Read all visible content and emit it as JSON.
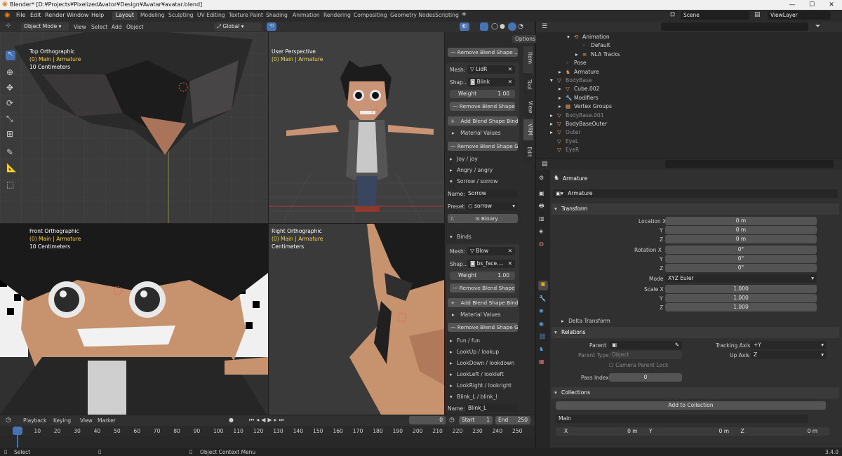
{
  "window": {
    "title": "Blender* [D:¥Projects¥PixelizedAvator¥Design¥Avatar¥avatar.blend]",
    "controls": [
      "—",
      "☐",
      "✕"
    ]
  },
  "menubar": {
    "items": [
      "File",
      "Edit",
      "Render",
      "Window",
      "Help"
    ]
  },
  "workspaces": [
    "Layout",
    "Modeling",
    "Sculpting",
    "UV Editing",
    "Texture Paint",
    "Shading",
    "Animation",
    "Rendering",
    "Compositing",
    "Geometry Nodes",
    "Scripting"
  ],
  "scene": {
    "name": "Scene",
    "view_layer": "ViewLayer"
  },
  "viewport_header": {
    "mode": "Object Mode",
    "menus": [
      "View",
      "Select",
      "Add",
      "Object"
    ],
    "transform": "Global",
    "options": "Options"
  },
  "viewports": {
    "top": {
      "title": "Top Orthographic",
      "sub": "(0) Main | Armature",
      "scale": "10 Centimeters"
    },
    "persp": {
      "title": "User Perspective",
      "sub": "(0) Main | Armature"
    },
    "front": {
      "title": "Front Orthographic",
      "sub": "(0) Main | Armature",
      "scale": "10 Centimeters"
    },
    "right": {
      "title": "Right Orthographic",
      "sub": "(0) Main | Armature",
      "scale": "Centimeters"
    }
  },
  "sidebar": {
    "tabs": [
      "Item",
      "Tool",
      "View",
      "VRM",
      "Edit"
    ],
    "remove_blend_shape": "Remove Blend Shape ...",
    "mesh_label": "Mesh:",
    "shape_label": "Shap...",
    "bind1": {
      "mesh": "LidR",
      "shape": "Blink",
      "weight_label": "Weight",
      "weight": "1.00"
    },
    "add_bind": "Add Blend Shape Bind",
    "material_values": "Material Values",
    "remove_group": "Remove Blend Shape Gr...",
    "groups_a": [
      "Joy / joy",
      "Angry / angry",
      "Sorrow / sorrow"
    ],
    "name_label": "Name:",
    "name_value": "Sorrow",
    "preset_label": "Preset:",
    "preset_value": "sorrow",
    "is_binary": "Is Binary",
    "binds": "Binds",
    "bind2": {
      "mesh": "Blow",
      "shape": "bs_face....",
      "weight_label": "Weight",
      "weight": "1.00"
    },
    "groups_b": [
      "Fun / fun",
      "LookUp / lookup",
      "LookDown / lookdown",
      "LookLeft / lookleft",
      "LookRight / lookright",
      "Blink_L / blink_l"
    ],
    "name2_value": "Blink_L"
  },
  "outliner": {
    "rows": [
      {
        "label": "Animation",
        "indent": 3,
        "arrow": "▾",
        "icon": "⟲",
        "dim": false
      },
      {
        "label": "Default",
        "indent": 4,
        "arrow": "",
        "icon": "◦",
        "dim": false
      },
      {
        "label": "NLA Tracks",
        "indent": 4,
        "arrow": "▸",
        "icon": "≡",
        "dim": false
      },
      {
        "label": "Pose",
        "indent": 2,
        "arrow": "",
        "icon": "◦",
        "dim": false
      },
      {
        "label": "Armature",
        "indent": 2,
        "arrow": "▸",
        "icon": "♞",
        "dim": false
      },
      {
        "label": "BodyBase",
        "indent": 1,
        "arrow": "▾",
        "icon": "▽",
        "dim": true
      },
      {
        "label": "Cube.002",
        "indent": 2,
        "arrow": "▸",
        "icon": "▽",
        "dim": false
      },
      {
        "label": "Modifiers",
        "indent": 2,
        "arrow": "▸",
        "icon": "🔧",
        "dim": false
      },
      {
        "label": "Vertex Groups",
        "indent": 2,
        "arrow": "▸",
        "icon": "▦",
        "dim": false
      },
      {
        "label": "BodyBase.001",
        "indent": 1,
        "arrow": "▸",
        "icon": "▽",
        "dim": true
      },
      {
        "label": "BodyBaseOuter",
        "indent": 1,
        "arrow": "▸",
        "icon": "▽",
        "dim": false
      },
      {
        "label": "Outer",
        "indent": 1,
        "arrow": "▸",
        "icon": "▽",
        "dim": true
      },
      {
        "label": "EyeL",
        "indent": 1,
        "arrow": "",
        "icon": "▽",
        "dim": true
      },
      {
        "label": "EyeR",
        "indent": 1,
        "arrow": "",
        "icon": "▽",
        "dim": true
      }
    ]
  },
  "properties": {
    "object": "Armature",
    "data_name": "Armature",
    "transform": {
      "header": "Transform",
      "location_label": "Location X",
      "location": [
        "0 m",
        "0 m",
        "0 m"
      ],
      "rotation_label": "Rotation X",
      "rotation": [
        "0°",
        "0°",
        "0°"
      ],
      "mode_label": "Mode",
      "mode": "XYZ Euler",
      "scale_label": "Scale X",
      "scale": [
        "1.000",
        "1.000",
        "1.000"
      ],
      "axis_y": "Y",
      "axis_z": "Z"
    },
    "delta": "Delta Transform",
    "relations": {
      "header": "Relations",
      "parent": "Parent",
      "parent_type": "Parent Type",
      "parent_type_value": "Object",
      "camera_parent_lock": "Camera Parent Lock",
      "pass_index": "Pass Index",
      "pass_value": "0",
      "tracking_axis": "Tracking Axis",
      "tracking_value": "+Y",
      "up_axis": "Up Axis",
      "up_value": "Z"
    },
    "collections": {
      "header": "Collections",
      "add": "Add to Collection",
      "name": "Main",
      "x_label": "X",
      "x": "0 m",
      "y_label": "Y",
      "y": "0 m",
      "z_label": "Z",
      "z": "0 m"
    }
  },
  "timeline": {
    "menus": [
      "Playback",
      "Keying",
      "View",
      "Marker"
    ],
    "current": "0",
    "start_label": "Start",
    "start": "1",
    "end_label": "End",
    "end": "250",
    "ticks": [
      "0",
      "10",
      "20",
      "30",
      "40",
      "50",
      "60",
      "70",
      "80",
      "90",
      "100",
      "110",
      "120",
      "130",
      "140",
      "150",
      "160",
      "170",
      "180",
      "190",
      "200",
      "210",
      "220",
      "230",
      "240",
      "250"
    ]
  },
  "status": {
    "select": "Select",
    "context": "Object Context Menu",
    "version": "3.4.0"
  },
  "colors": {
    "accent": "#4772b3",
    "selected_text": "#f5d245",
    "bg": "#1d1d1d",
    "panel": "#303030",
    "field": "#545454"
  }
}
